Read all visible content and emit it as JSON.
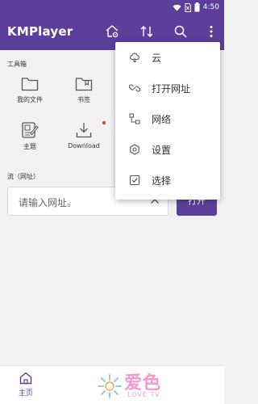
{
  "status_bar": {
    "time": "4:50"
  },
  "app_bar": {
    "title": "KMPlayer",
    "icons": [
      "home-settings-icon",
      "sort-icon",
      "search-icon",
      "more-vert-icon"
    ]
  },
  "toolbox": {
    "label": "工具箱",
    "tools": [
      {
        "label": "我的文件",
        "icon": "folder-icon"
      },
      {
        "label": "书签",
        "icon": "bookmark-folder-icon"
      },
      {
        "label": "主题",
        "icon": "theme-icon"
      },
      {
        "label": "Download",
        "icon": "download-icon"
      }
    ]
  },
  "stream": {
    "label": "流（网址）",
    "url_placeholder": "请输入网址。",
    "open_label": "打开"
  },
  "overflow_menu": {
    "items": [
      {
        "label": "云",
        "icon": "cloud-icon"
      },
      {
        "label": "打开网址",
        "icon": "link-icon"
      },
      {
        "label": "网络",
        "icon": "network-icon"
      },
      {
        "label": "设置",
        "icon": "settings-icon"
      },
      {
        "label": "选择",
        "icon": "checkbox-icon"
      }
    ]
  },
  "bottom_nav": {
    "home_label": "主页"
  },
  "watermark": {
    "main": "爱色",
    "sub": "LOVE TV"
  },
  "colors": {
    "primary": "#5b3f9a",
    "background": "#f2f2f5",
    "badge": "#e53935"
  }
}
